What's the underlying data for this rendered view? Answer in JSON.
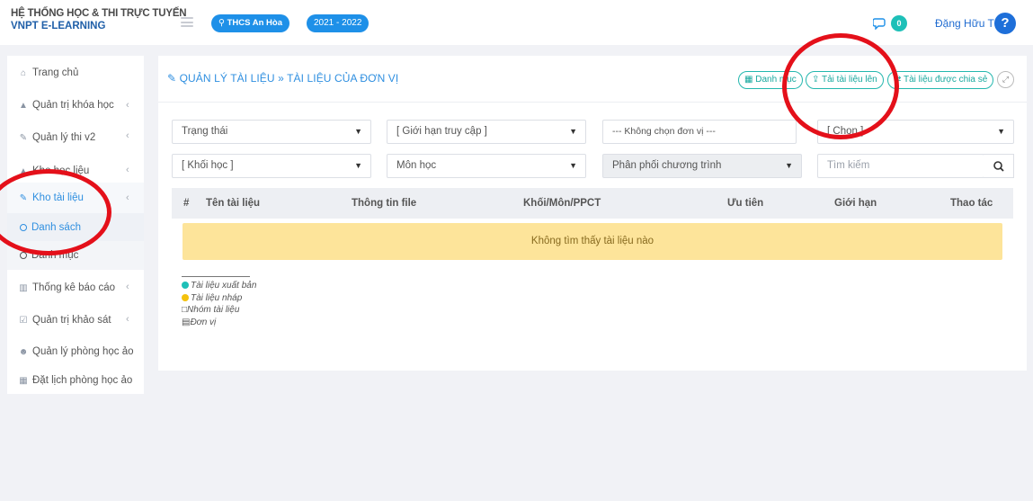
{
  "header": {
    "brand_line1": "HỆ THỐNG HỌC & THI TRỰC TUYẾN",
    "brand_line2": "VNPT E-LEARNING",
    "school": "THCS An Hòa",
    "year": "2021 - 2022",
    "notifications": "0",
    "user_name": "Đặng Hữu Tú",
    "help": "?"
  },
  "sidebar": {
    "items": [
      {
        "label": "Trang chủ"
      },
      {
        "label": "Quản trị khóa học"
      },
      {
        "label": "Quản lý thi v2"
      },
      {
        "label": "Kho học liệu"
      },
      {
        "label": "Kho tài liệu"
      },
      {
        "label": "Danh sách"
      },
      {
        "label": "Danh mục"
      },
      {
        "label": "Thống kê báo cáo"
      },
      {
        "label": "Quản trị khảo sát"
      },
      {
        "label": "Quản lý phòng học ảo"
      },
      {
        "label": "Đặt lịch phòng học ảo"
      }
    ]
  },
  "main": {
    "title": "QUẢN LÝ TÀI LIỆU » TÀI LIỆU CỦA ĐƠN VỊ",
    "buttons": {
      "category": "Danh mục",
      "upload": "Tải tài liệu lên",
      "shared": "Tài liệu được chia sẻ"
    },
    "filters": {
      "status": "Trạng thái",
      "access": "[ Giới hạn truy cập ]",
      "unit": "--- Không chọn đơn vị ---",
      "choose": "[ Chọn ]",
      "grade": "[ Khối học ]",
      "subject": "Môn học",
      "program": "Phân phối chương trình",
      "search_placeholder": "Tìm kiếm"
    },
    "table": {
      "columns": [
        "#",
        "Tên tài liệu",
        "Thông tin file",
        "Khối/Môn/PPCT",
        "Ưu tiên",
        "Giới hạn",
        "Thao tác"
      ],
      "empty": "Không tìm thấy tài liệu nào"
    },
    "legend": {
      "published": "Tài liệu xuất bản",
      "draft": "Tài liệu nháp",
      "group": "Nhóm tài liệu",
      "unit": "Đơn vị"
    }
  },
  "colors": {
    "primary": "#1e90e8",
    "teal": "#1ec0b8",
    "warning_bg": "#fde49a",
    "annotation_red": "#e4101a"
  }
}
